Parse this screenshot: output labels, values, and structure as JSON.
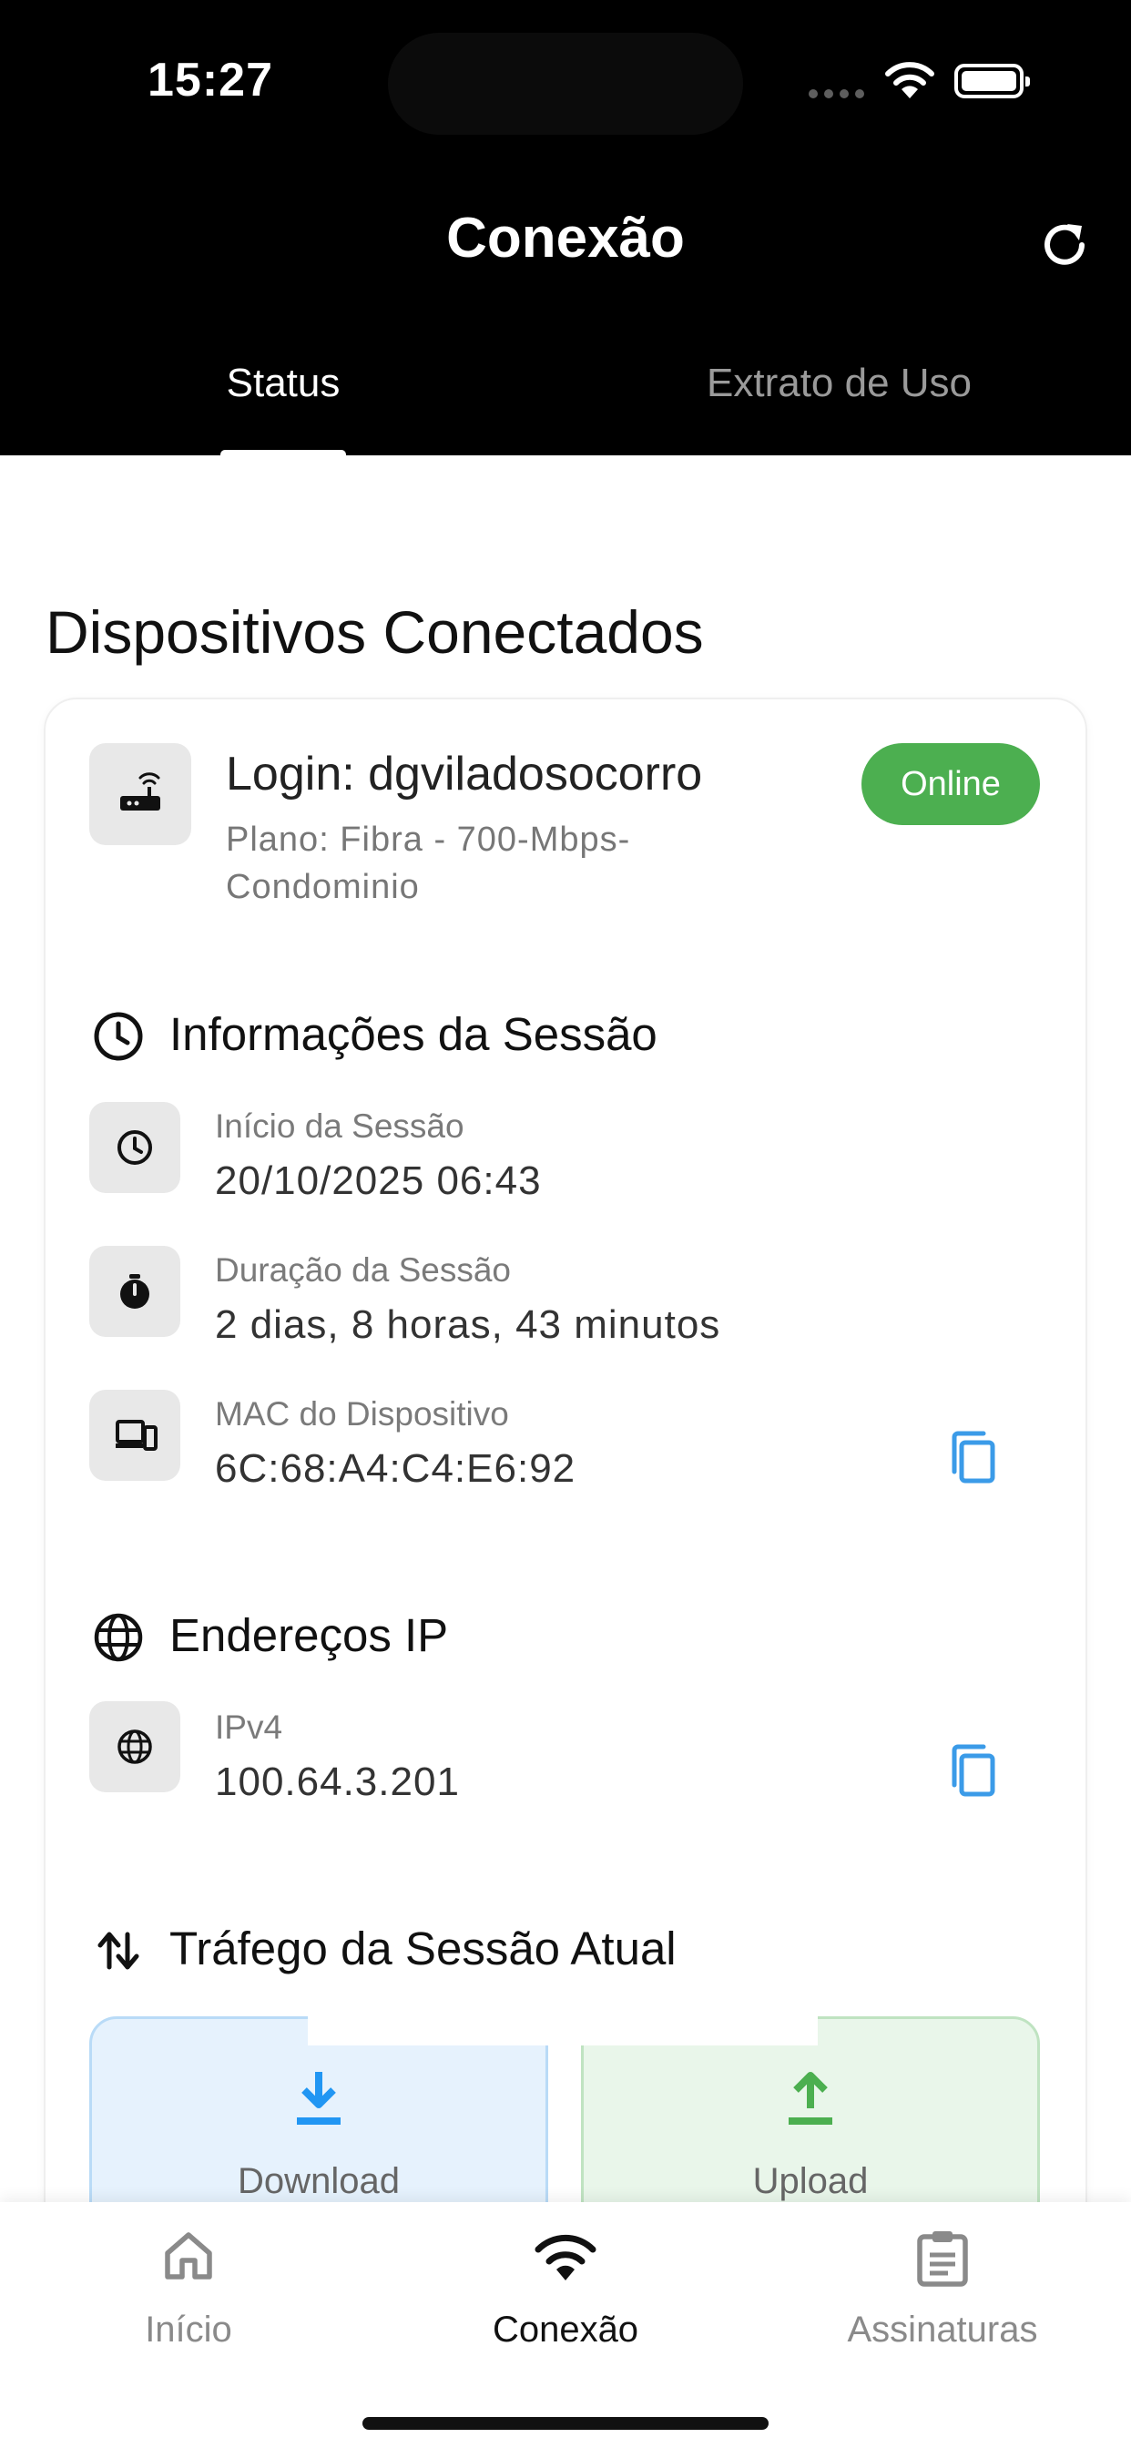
{
  "status_bar": {
    "time": "15:27"
  },
  "header": {
    "title": "Conexão"
  },
  "tabs": [
    {
      "label": "Status",
      "active": true
    },
    {
      "label": "Extrato de Uso",
      "active": false
    }
  ],
  "section_title": "Dispositivos Conectados",
  "device": {
    "login": "Login: dgviladosocorro",
    "plano": "Plano: Fibra - 700-Mbps-Condominio",
    "status": "Online"
  },
  "session": {
    "title": "Informações da Sessão",
    "inicio_label": "Início da Sessão",
    "inicio_value": "20/10/2025 06:43",
    "duracao_label": "Duração da Sessão",
    "duracao_value": "2 dias, 8 horas, 43 minutos",
    "mac_label": "MAC do Dispositivo",
    "mac_value": "6C:68:A4:C4:E6:92"
  },
  "ip": {
    "title": "Endereços IP",
    "ipv4_label": "IPv4",
    "ipv4_value": "100.64.3.201"
  },
  "traffic": {
    "title": "Tráfego da Sessão Atual",
    "download_label": "Download",
    "upload_label": "Upload"
  },
  "bottom_nav": [
    {
      "label": "Início",
      "icon": "home-icon",
      "active": false
    },
    {
      "label": "Conexão",
      "icon": "wifi-icon",
      "active": true
    },
    {
      "label": "Assinaturas",
      "icon": "clipboard-icon",
      "active": false
    }
  ],
  "colors": {
    "online": "#4caf50",
    "copy": "#3b9be8",
    "download": "#2196f3",
    "upload": "#4caf50"
  }
}
